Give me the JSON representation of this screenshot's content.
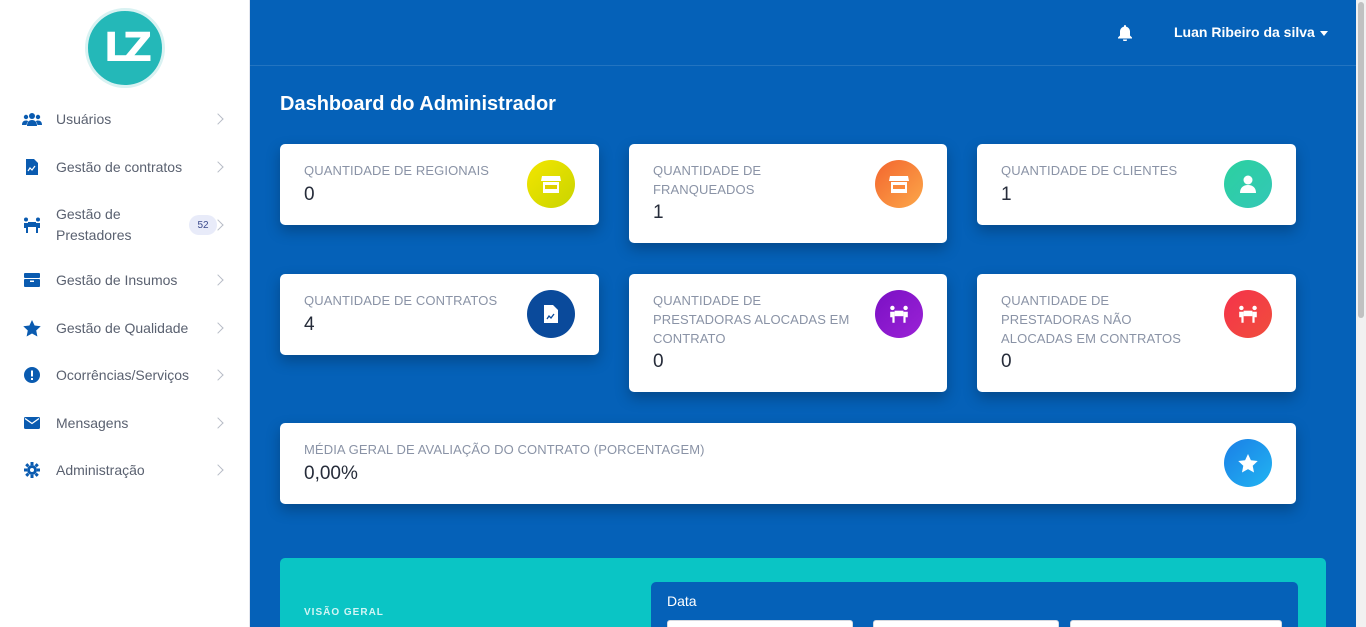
{
  "app": {
    "logo_text": "LZ"
  },
  "sidebar": {
    "items": [
      {
        "label": "Usuários",
        "icon": "users-icon"
      },
      {
        "label": "Gestão de contratos",
        "icon": "contract-file-icon"
      },
      {
        "label": "Gestão de Prestadores",
        "icon": "people-carry-icon",
        "badge": "52"
      },
      {
        "label": "Gestão de Insumos",
        "icon": "box-icon"
      },
      {
        "label": "Gestão de Qualidade",
        "icon": "star-icon"
      },
      {
        "label": "Ocorrências/Serviços",
        "icon": "exclamation-circle-icon"
      },
      {
        "label": "Mensagens",
        "icon": "envelope-icon"
      },
      {
        "label": "Administração",
        "icon": "gear-icon"
      }
    ]
  },
  "header": {
    "user_name": "Luan Ribeiro da silva"
  },
  "main": {
    "title": "Dashboard do Administrador",
    "cards": [
      {
        "label": "Quantidade de Regionais",
        "value": "0",
        "icon": "store-icon",
        "color": "#e6d200"
      },
      {
        "label": "Quantidade de Franqueados",
        "value": "1",
        "icon": "store-icon",
        "color": "#fb7a3a"
      },
      {
        "label": "Quantidade de Clientes",
        "value": "1",
        "icon": "user-icon",
        "color": "#2dcf9f"
      },
      {
        "label": "Quantidade de Contratos",
        "value": "4",
        "icon": "contract-file-icon",
        "color": "#0a4a9b"
      },
      {
        "label": "Quantidade de Prestadoras alocadas em contrato",
        "value": "0",
        "icon": "people-carry-icon",
        "color": "#8a18c9"
      },
      {
        "label": "Quantidade de Prestadoras não alocadas em contratos",
        "value": "0",
        "icon": "people-carry-icon",
        "color": "#f2374a"
      },
      {
        "label": "Média geral de avaliação do contrato (porcentagem)",
        "value": "0,00%",
        "icon": "star-icon",
        "color": "#1a9aee"
      }
    ],
    "overview": {
      "label": "Visão geral",
      "date_label": "Data"
    }
  }
}
